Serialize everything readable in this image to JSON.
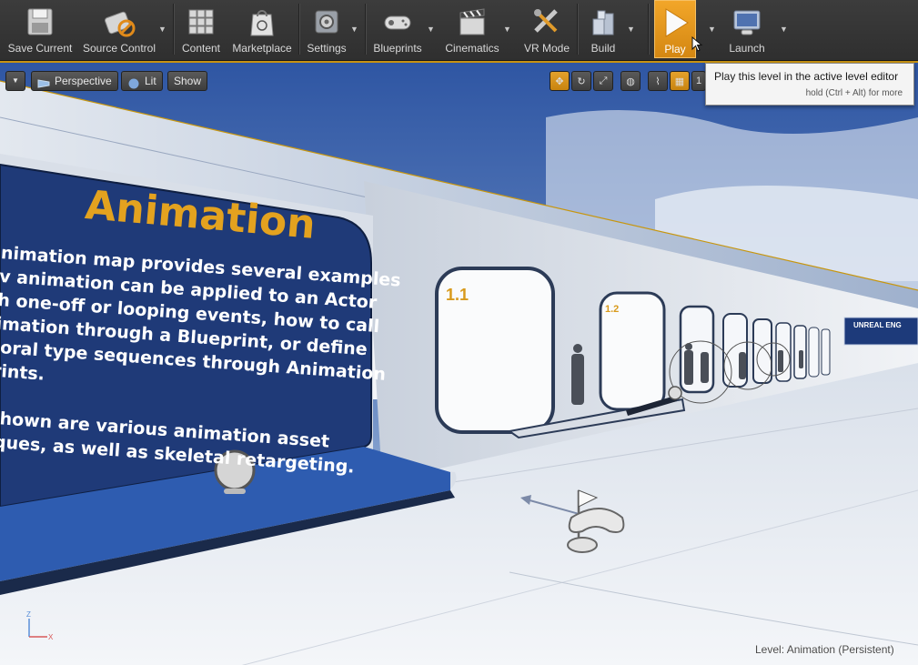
{
  "toolbar": {
    "items": [
      {
        "label": "Save Current",
        "icon": "save-icon",
        "dropdown": false
      },
      {
        "label": "Source Control",
        "icon": "source-control-icon",
        "dropdown": true
      },
      {
        "label": "Content",
        "icon": "content-icon",
        "dropdown": false
      },
      {
        "label": "Marketplace",
        "icon": "marketplace-icon",
        "dropdown": false
      },
      {
        "label": "Settings",
        "icon": "settings-icon",
        "dropdown": true
      },
      {
        "label": "Blueprints",
        "icon": "blueprints-icon",
        "dropdown": true
      },
      {
        "label": "Cinematics",
        "icon": "cinematics-icon",
        "dropdown": true
      },
      {
        "label": "VR Mode",
        "icon": "vr-mode-icon",
        "dropdown": false
      },
      {
        "label": "Build",
        "icon": "build-icon",
        "dropdown": true
      },
      {
        "label": "Play",
        "icon": "play-icon",
        "dropdown": true,
        "active": true
      },
      {
        "label": "Launch",
        "icon": "launch-icon",
        "dropdown": true
      }
    ]
  },
  "viewport": {
    "perspective_label": "Perspective",
    "lit_label": "Lit",
    "show_label": "Show",
    "grid_value": "1",
    "level_label": "Level:  Animation (Persistent)"
  },
  "tooltip": {
    "main": "Play this level in the active level editor",
    "hint": "hold (Ctrl + Alt) for more"
  },
  "scene": {
    "panel_title": "Animation",
    "panel_lines": [
      "nimation map provides several examples",
      "v animation can be applied to an Actor",
      "h one-off or looping events, how to call",
      "imation through a Blueprint, or define",
      "ioral type sequences through Animation",
      "rints.",
      "",
      "shown are various animation asset",
      "iques, as well as skeletal retargeting."
    ],
    "room_label_1": "1.1",
    "room_label_2": "1.2",
    "sign_text": "UNREAL ENG"
  },
  "colors": {
    "accent": "#e0a02a",
    "panel_blue": "#1f3a78",
    "title_gold": "#e3a21f",
    "sky_top": "#3b5fa8",
    "floor": "#e8ecf2"
  }
}
